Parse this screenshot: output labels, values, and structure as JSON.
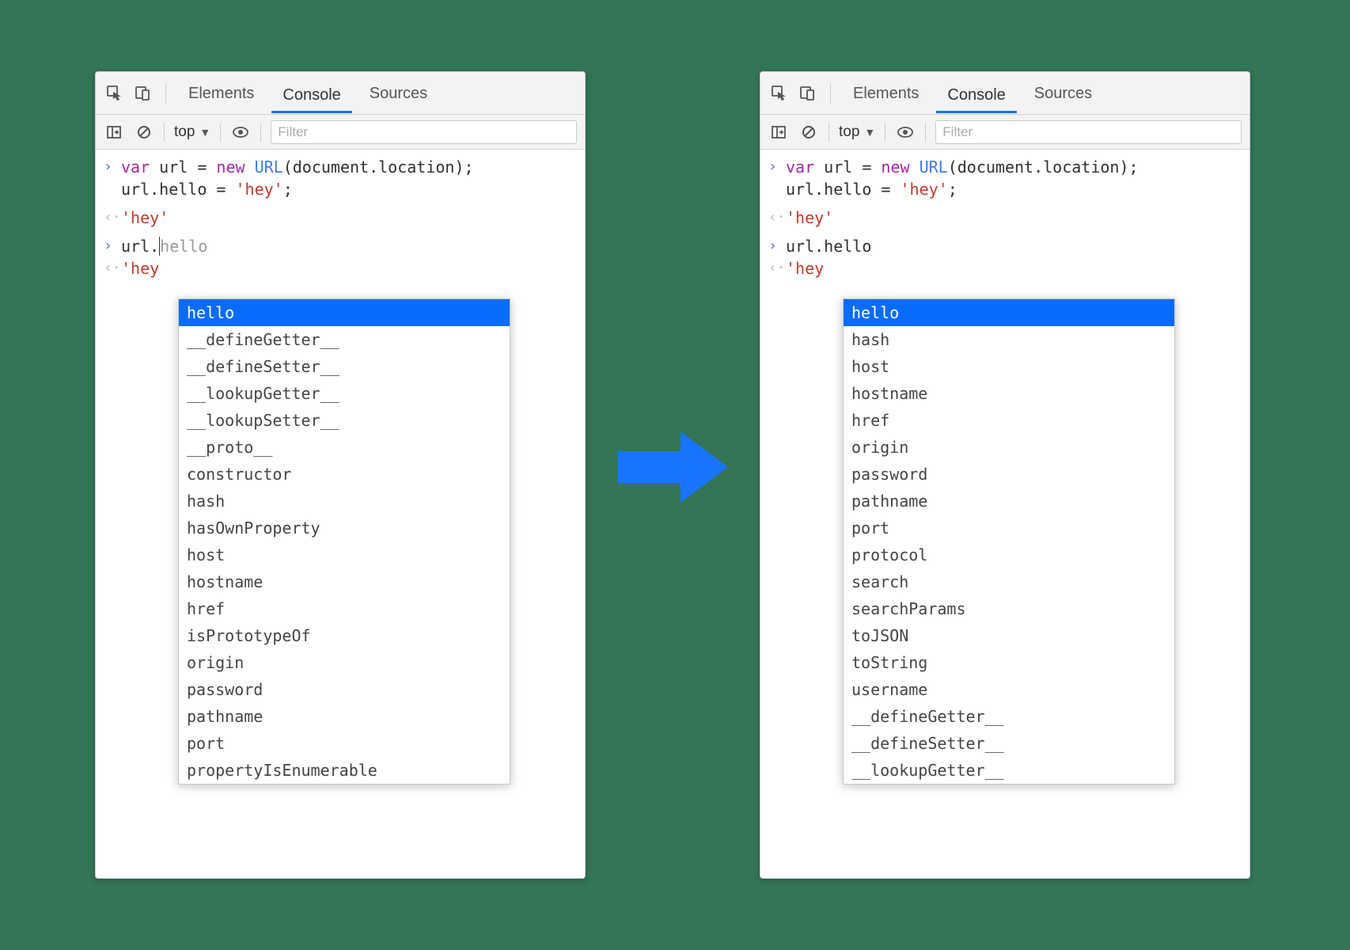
{
  "tabs": {
    "elements": "Elements",
    "console": "Console",
    "sources": "Sources"
  },
  "toolbar": {
    "context": "top",
    "filter_placeholder": "Filter"
  },
  "code": {
    "kw_var": "var",
    "id_url": "url",
    "eq": " = ",
    "kw_new": "new",
    "cls_url": "URL",
    "arg": "(document.location);",
    "line2_a": "url.hello = ",
    "line2_str": "'hey'",
    "line2_end": ";",
    "out1": "'hey'",
    "line4": "url.",
    "line4_suffix": "hello",
    "out2": "'hey"
  },
  "popup_left": {
    "selected": "hello",
    "items": [
      "hello",
      "__defineGetter__",
      "__defineSetter__",
      "__lookupGetter__",
      "__lookupSetter__",
      "__proto__",
      "constructor",
      "hash",
      "hasOwnProperty",
      "host",
      "hostname",
      "href",
      "isPrototypeOf",
      "origin",
      "password",
      "pathname",
      "port",
      "propertyIsEnumerable"
    ]
  },
  "popup_right": {
    "selected": "hello",
    "items": [
      "hello",
      "hash",
      "host",
      "hostname",
      "href",
      "origin",
      "password",
      "pathname",
      "port",
      "protocol",
      "search",
      "searchParams",
      "toJSON",
      "toString",
      "username",
      "__defineGetter__",
      "__defineSetter__",
      "__lookupGetter__"
    ]
  }
}
